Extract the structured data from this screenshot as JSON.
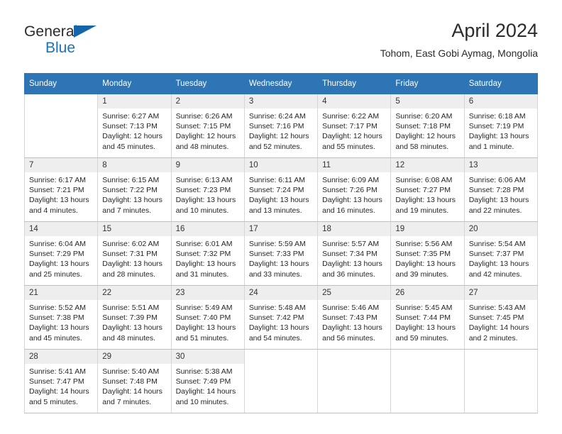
{
  "brand": {
    "line1": "General",
    "line2": "Blue",
    "triangle_icon": "brand-triangle-icon",
    "colors": {
      "blue": "#1a72c0",
      "triangle": "#1565aa",
      "dark": "#2b2b2b"
    }
  },
  "header": {
    "title": "April 2024",
    "subtitle": "Tohom, East Gobi Aymag, Mongolia"
  },
  "calendar": {
    "accent_color": "#2e75b6",
    "daynum_bg": "#eeeeee",
    "weekday_headers": [
      "Sunday",
      "Monday",
      "Tuesday",
      "Wednesday",
      "Thursday",
      "Friday",
      "Saturday"
    ],
    "weeks": [
      [
        {
          "day": "",
          "sunrise": "",
          "sunset": "",
          "daylight": "",
          "empty": true
        },
        {
          "day": "1",
          "sunrise": "Sunrise: 6:27 AM",
          "sunset": "Sunset: 7:13 PM",
          "daylight": "Daylight: 12 hours and 45 minutes."
        },
        {
          "day": "2",
          "sunrise": "Sunrise: 6:26 AM",
          "sunset": "Sunset: 7:15 PM",
          "daylight": "Daylight: 12 hours and 48 minutes."
        },
        {
          "day": "3",
          "sunrise": "Sunrise: 6:24 AM",
          "sunset": "Sunset: 7:16 PM",
          "daylight": "Daylight: 12 hours and 52 minutes."
        },
        {
          "day": "4",
          "sunrise": "Sunrise: 6:22 AM",
          "sunset": "Sunset: 7:17 PM",
          "daylight": "Daylight: 12 hours and 55 minutes."
        },
        {
          "day": "5",
          "sunrise": "Sunrise: 6:20 AM",
          "sunset": "Sunset: 7:18 PM",
          "daylight": "Daylight: 12 hours and 58 minutes."
        },
        {
          "day": "6",
          "sunrise": "Sunrise: 6:18 AM",
          "sunset": "Sunset: 7:19 PM",
          "daylight": "Daylight: 13 hours and 1 minute."
        }
      ],
      [
        {
          "day": "7",
          "sunrise": "Sunrise: 6:17 AM",
          "sunset": "Sunset: 7:21 PM",
          "daylight": "Daylight: 13 hours and 4 minutes."
        },
        {
          "day": "8",
          "sunrise": "Sunrise: 6:15 AM",
          "sunset": "Sunset: 7:22 PM",
          "daylight": "Daylight: 13 hours and 7 minutes."
        },
        {
          "day": "9",
          "sunrise": "Sunrise: 6:13 AM",
          "sunset": "Sunset: 7:23 PM",
          "daylight": "Daylight: 13 hours and 10 minutes."
        },
        {
          "day": "10",
          "sunrise": "Sunrise: 6:11 AM",
          "sunset": "Sunset: 7:24 PM",
          "daylight": "Daylight: 13 hours and 13 minutes."
        },
        {
          "day": "11",
          "sunrise": "Sunrise: 6:09 AM",
          "sunset": "Sunset: 7:26 PM",
          "daylight": "Daylight: 13 hours and 16 minutes."
        },
        {
          "day": "12",
          "sunrise": "Sunrise: 6:08 AM",
          "sunset": "Sunset: 7:27 PM",
          "daylight": "Daylight: 13 hours and 19 minutes."
        },
        {
          "day": "13",
          "sunrise": "Sunrise: 6:06 AM",
          "sunset": "Sunset: 7:28 PM",
          "daylight": "Daylight: 13 hours and 22 minutes."
        }
      ],
      [
        {
          "day": "14",
          "sunrise": "Sunrise: 6:04 AM",
          "sunset": "Sunset: 7:29 PM",
          "daylight": "Daylight: 13 hours and 25 minutes."
        },
        {
          "day": "15",
          "sunrise": "Sunrise: 6:02 AM",
          "sunset": "Sunset: 7:31 PM",
          "daylight": "Daylight: 13 hours and 28 minutes."
        },
        {
          "day": "16",
          "sunrise": "Sunrise: 6:01 AM",
          "sunset": "Sunset: 7:32 PM",
          "daylight": "Daylight: 13 hours and 31 minutes."
        },
        {
          "day": "17",
          "sunrise": "Sunrise: 5:59 AM",
          "sunset": "Sunset: 7:33 PM",
          "daylight": "Daylight: 13 hours and 33 minutes."
        },
        {
          "day": "18",
          "sunrise": "Sunrise: 5:57 AM",
          "sunset": "Sunset: 7:34 PM",
          "daylight": "Daylight: 13 hours and 36 minutes."
        },
        {
          "day": "19",
          "sunrise": "Sunrise: 5:56 AM",
          "sunset": "Sunset: 7:35 PM",
          "daylight": "Daylight: 13 hours and 39 minutes."
        },
        {
          "day": "20",
          "sunrise": "Sunrise: 5:54 AM",
          "sunset": "Sunset: 7:37 PM",
          "daylight": "Daylight: 13 hours and 42 minutes."
        }
      ],
      [
        {
          "day": "21",
          "sunrise": "Sunrise: 5:52 AM",
          "sunset": "Sunset: 7:38 PM",
          "daylight": "Daylight: 13 hours and 45 minutes."
        },
        {
          "day": "22",
          "sunrise": "Sunrise: 5:51 AM",
          "sunset": "Sunset: 7:39 PM",
          "daylight": "Daylight: 13 hours and 48 minutes."
        },
        {
          "day": "23",
          "sunrise": "Sunrise: 5:49 AM",
          "sunset": "Sunset: 7:40 PM",
          "daylight": "Daylight: 13 hours and 51 minutes."
        },
        {
          "day": "24",
          "sunrise": "Sunrise: 5:48 AM",
          "sunset": "Sunset: 7:42 PM",
          "daylight": "Daylight: 13 hours and 54 minutes."
        },
        {
          "day": "25",
          "sunrise": "Sunrise: 5:46 AM",
          "sunset": "Sunset: 7:43 PM",
          "daylight": "Daylight: 13 hours and 56 minutes."
        },
        {
          "day": "26",
          "sunrise": "Sunrise: 5:45 AM",
          "sunset": "Sunset: 7:44 PM",
          "daylight": "Daylight: 13 hours and 59 minutes."
        },
        {
          "day": "27",
          "sunrise": "Sunrise: 5:43 AM",
          "sunset": "Sunset: 7:45 PM",
          "daylight": "Daylight: 14 hours and 2 minutes."
        }
      ],
      [
        {
          "day": "28",
          "sunrise": "Sunrise: 5:41 AM",
          "sunset": "Sunset: 7:47 PM",
          "daylight": "Daylight: 14 hours and 5 minutes."
        },
        {
          "day": "29",
          "sunrise": "Sunrise: 5:40 AM",
          "sunset": "Sunset: 7:48 PM",
          "daylight": "Daylight: 14 hours and 7 minutes."
        },
        {
          "day": "30",
          "sunrise": "Sunrise: 5:38 AM",
          "sunset": "Sunset: 7:49 PM",
          "daylight": "Daylight: 14 hours and 10 minutes."
        },
        {
          "day": "",
          "sunrise": "",
          "sunset": "",
          "daylight": "",
          "empty": true
        },
        {
          "day": "",
          "sunrise": "",
          "sunset": "",
          "daylight": "",
          "empty": true
        },
        {
          "day": "",
          "sunrise": "",
          "sunset": "",
          "daylight": "",
          "empty": true
        },
        {
          "day": "",
          "sunrise": "",
          "sunset": "",
          "daylight": "",
          "empty": true
        }
      ]
    ]
  }
}
